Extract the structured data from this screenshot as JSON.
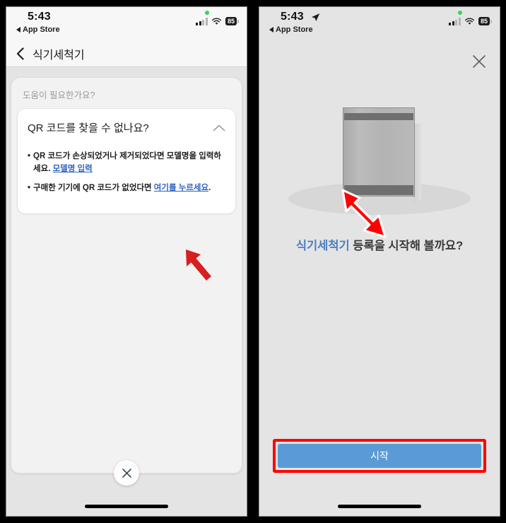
{
  "screens": {
    "left": {
      "statusbar": {
        "time": "5:43",
        "back_label": "App Store",
        "battery": "85",
        "icons": [
          "recording-dot",
          "cellular-signal-icon",
          "wifi-icon",
          "battery-icon"
        ]
      },
      "navbar": {
        "back_icon": "chevron-left-icon",
        "title": "식기세척기"
      },
      "sheet": {
        "header": "도움이 필요한가요?",
        "card": {
          "title": "QR 코드를 찾을 수 없나요?",
          "collapse_icon": "chevron-up-icon",
          "bullets": [
            {
              "marker": "•",
              "text_before": "QR 코드가 손상되었거나 제거되었다면 모델명을 입력하세요. ",
              "link": "모델명 입력",
              "text_after": ""
            },
            {
              "marker": "•",
              "text_before": "구매한 기기에 QR 코드가 없었다면 ",
              "link": "여기를 누르세요",
              "text_after": "."
            }
          ]
        },
        "close_icon": "close-x-icon"
      },
      "annotation": {
        "arrow": "red-arrow-up-left",
        "color": "#d81f1f",
        "points_to": "여기를 누르세요"
      }
    },
    "right": {
      "statusbar": {
        "time": "5:43",
        "location_icon": "location-arrow-icon",
        "back_label": "App Store",
        "battery": "85",
        "icons": [
          "recording-dot",
          "cellular-signal-icon",
          "wifi-icon",
          "battery-icon"
        ]
      },
      "close_icon": "close-x-icon",
      "illustration": {
        "name": "dishwasher-illustration",
        "body_color": "#b3b3b3",
        "panel_color": "#6f6f6f"
      },
      "headline": {
        "highlight": "식기세척기",
        "rest": " 등록을 시작해 볼까요?",
        "highlight_color": "#4a7fc1"
      },
      "start_button": {
        "label": "시작",
        "color": "#5b9bd5"
      },
      "annotation": {
        "arrow": "red-arrow-down-right",
        "color": "#ff0000",
        "highlight_box_color": "#ff0000",
        "points_to": "시작"
      }
    }
  }
}
